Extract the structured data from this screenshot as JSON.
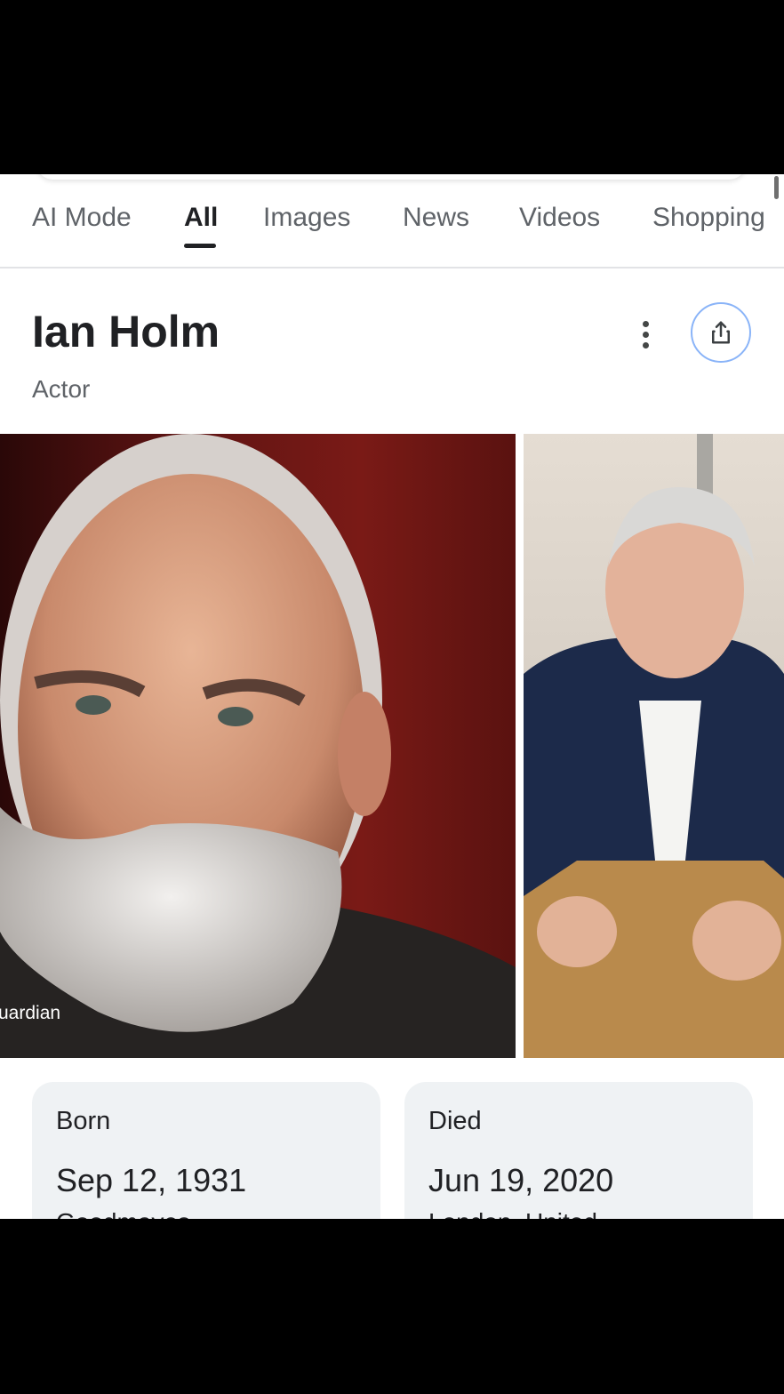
{
  "tabs": [
    {
      "label": "AI Mode",
      "active": false
    },
    {
      "label": "All",
      "active": true
    },
    {
      "label": "Images",
      "active": false
    },
    {
      "label": "News",
      "active": false
    },
    {
      "label": "Videos",
      "active": false
    },
    {
      "label": "Shopping",
      "active": false
    }
  ],
  "entity": {
    "name": "Ian Holm",
    "description": "Actor"
  },
  "images": {
    "main_source": "uardian"
  },
  "facts": [
    {
      "label": "Born",
      "value": "Sep 12, 1931",
      "place": "Goodmayes"
    },
    {
      "label": "Died",
      "value": "Jun 19, 2020",
      "place": "London, United"
    }
  ],
  "icons": {
    "more": "more-vert-icon",
    "share": "share-icon"
  },
  "colors": {
    "accent_border": "#8ab4f8",
    "text_primary": "#202124",
    "text_secondary": "#5f6368",
    "card_bg": "#eff2f4"
  }
}
